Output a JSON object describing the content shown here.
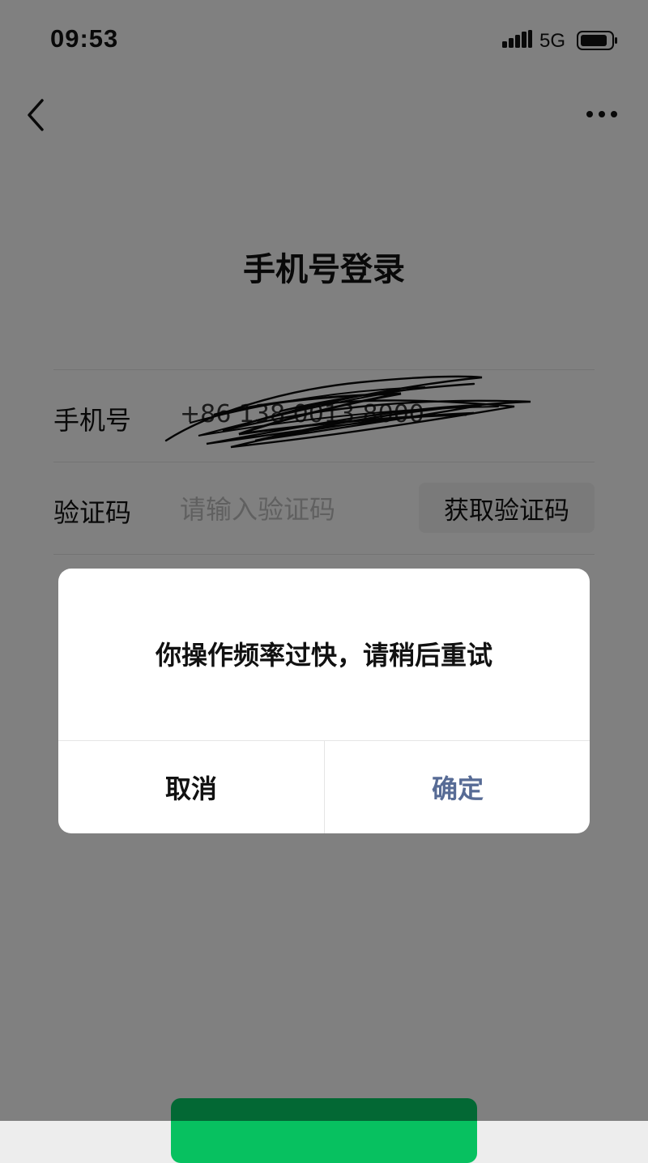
{
  "status_bar": {
    "time": "09:53",
    "network": "5G",
    "icons": [
      "signal-icon",
      "battery-icon"
    ]
  },
  "nav": {
    "icons": [
      "back-icon",
      "more-icon"
    ]
  },
  "page": {
    "title": "手机号登录",
    "phone_label": "手机号",
    "phone_value": "+86 138 0013 8000",
    "code_label": "验证码",
    "code_placeholder": "请输入验证码",
    "get_code_label": "获取验证码",
    "agreement_fragment": "",
    "login_button_label": ""
  },
  "dialog": {
    "message": "你操作频率过快，请稍后重试",
    "cancel_label": "取消",
    "confirm_label": "确定"
  },
  "colors": {
    "background": "#ededed",
    "link_blue": "#576b95",
    "primary_green": "#07c160",
    "dialog_bg": "#ffffff"
  }
}
